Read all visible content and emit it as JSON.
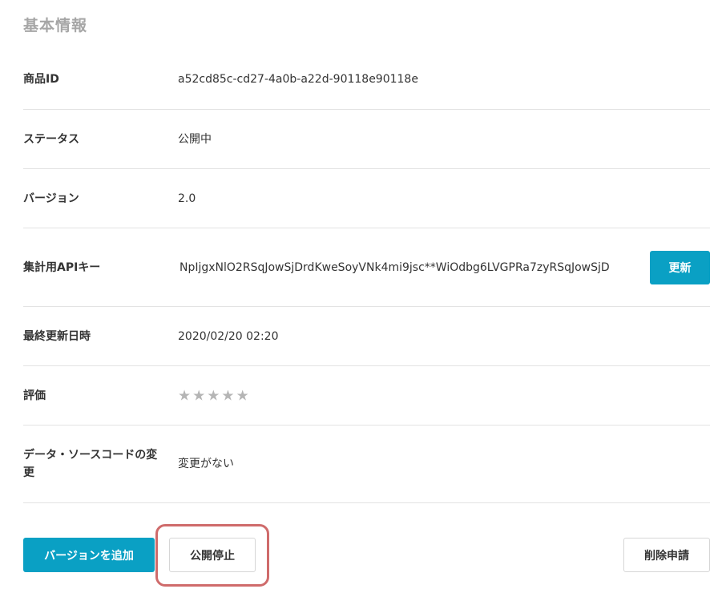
{
  "section": {
    "title": "基本情報"
  },
  "rows": {
    "product_id": {
      "label": "商品ID",
      "value": "a52cd85c-cd27-4a0b-a22d-90118e90118e"
    },
    "status": {
      "label": "ステータス",
      "value": "公開中"
    },
    "version": {
      "label": "バージョン",
      "value": "2.0"
    },
    "api_key": {
      "label": "集計用APIキー",
      "value": "NpIjgxNlO2RSqJowSjDrdKweSoyVNk4mi9jsc**WiOdbg6LVGPRa7zyRSqJowSjD",
      "refresh_label": "更新"
    },
    "last_updated": {
      "label": "最終更新日時",
      "value": "2020/02/20 02:20"
    },
    "rating": {
      "label": "評価",
      "stars_total": 5,
      "stars_filled": 0,
      "star_glyph": "★"
    },
    "source_change": {
      "label": "データ・ソースコードの変更",
      "value": "変更がない"
    }
  },
  "actions": {
    "add_version": "バージョンを追加",
    "unpublish": "公開停止",
    "delete_request": "削除申請"
  },
  "colors": {
    "accent": "#0aa0c4",
    "highlight": "#cf6b6b",
    "star_empty": "#b5b5b5"
  }
}
